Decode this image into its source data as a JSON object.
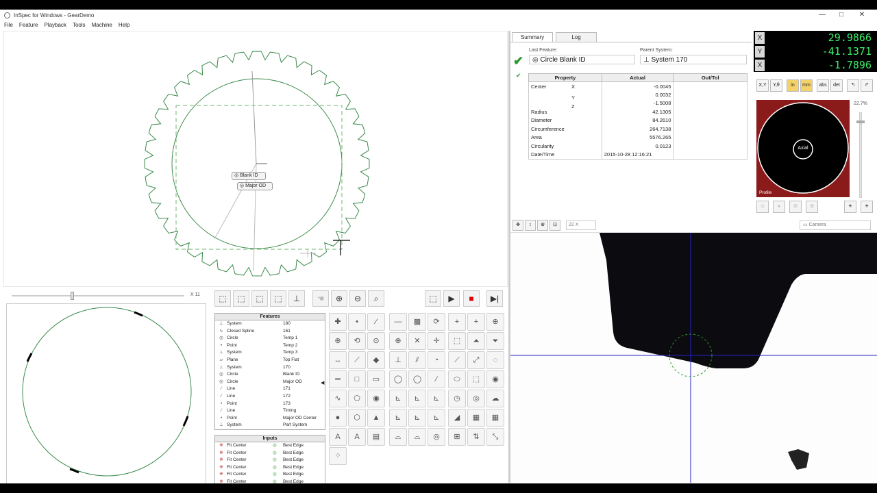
{
  "window": {
    "title": "InSpec for Windows - GearDemo",
    "minimize": "—",
    "maximize": "□",
    "close": "✕"
  },
  "menu": [
    "File",
    "Feature",
    "Playback",
    "Tools",
    "Machine",
    "Help"
  ],
  "canvas": {
    "tags": [
      "Blank ID",
      "Major OD"
    ]
  },
  "summary": {
    "tabs": [
      "Summary",
      "Log"
    ],
    "last_feature_label": "Last Feature:",
    "last_feature": "Circle Blank ID",
    "parent_system_label": "Parent System:",
    "parent_system": "System 170",
    "columns": [
      "Property",
      "Actual",
      "Out/Tol"
    ],
    "rows": [
      {
        "check": false,
        "prop": "Center",
        "axis": "X",
        "actual": "-0.0045"
      },
      {
        "check": false,
        "prop": "",
        "axis": "Y",
        "actual": "0.0032"
      },
      {
        "check": false,
        "prop": "",
        "axis": "Z",
        "actual": "-1.5008"
      },
      {
        "check": false,
        "prop": "Radius",
        "axis": "",
        "actual": "42.1305"
      },
      {
        "check": true,
        "prop": "Diameter",
        "axis": "",
        "actual": "84.2610"
      },
      {
        "check": false,
        "prop": "Circumference",
        "axis": "",
        "actual": "264.7138"
      },
      {
        "check": false,
        "prop": "Area",
        "axis": "",
        "actual": "5576.265"
      },
      {
        "check": false,
        "prop": "Circularity",
        "axis": "",
        "actual": "0.0123"
      },
      {
        "check": false,
        "prop": "Date/Time",
        "axis": "",
        "actual": "2015-10-28 12:16:21"
      }
    ]
  },
  "dro": {
    "x_label": "X",
    "x": "29.9866",
    "y_label": "Y",
    "y": "-41.1371",
    "z_label": "X",
    "z": "-1.7896"
  },
  "dro_tools": [
    "X,Y",
    "Y,θ",
    "in",
    "mm",
    "abs",
    "det",
    "↰",
    "↱"
  ],
  "light": {
    "center_label": "Axial",
    "footer_label": "Profile",
    "zoom_pct": "22.7%"
  },
  "camera": {
    "zoom": "22 X",
    "source": "Camera"
  },
  "preview": {
    "slider_label": "X 11"
  },
  "features": {
    "header": "Features",
    "items": [
      {
        "icon": "system",
        "type": "System",
        "name": "180"
      },
      {
        "icon": "spline",
        "type": "Closed Spline",
        "name": "161"
      },
      {
        "icon": "circle",
        "type": "Circle",
        "name": "Temp 1"
      },
      {
        "icon": "point",
        "type": "Point",
        "name": "Temp 2"
      },
      {
        "icon": "system",
        "type": "System",
        "name": "Temp 3"
      },
      {
        "icon": "plane",
        "type": "Plane",
        "name": "Top Flat"
      },
      {
        "icon": "system",
        "type": "System",
        "name": "170"
      },
      {
        "icon": "circle",
        "type": "Circle",
        "name": "Blank ID"
      },
      {
        "icon": "circle",
        "type": "Circle",
        "name": "Major OD"
      },
      {
        "icon": "line",
        "type": "Line",
        "name": "171"
      },
      {
        "icon": "line",
        "type": "Line",
        "name": "172"
      },
      {
        "icon": "point",
        "type": "Point",
        "name": "173"
      },
      {
        "icon": "line",
        "type": "Line",
        "name": "Timing"
      },
      {
        "icon": "point",
        "type": "Point",
        "name": "Major OD Center"
      },
      {
        "icon": "system",
        "type": "System",
        "name": "Part System"
      }
    ]
  },
  "inputs": {
    "header": "Inputs",
    "items": [
      {
        "type": "Fit Center",
        "edge": "Best Edge"
      },
      {
        "type": "Fit Center",
        "edge": "Best Edge"
      },
      {
        "type": "Fit Center",
        "edge": "Best Edge"
      },
      {
        "type": "Fit Center",
        "edge": "Best Edge"
      },
      {
        "type": "Fit Center",
        "edge": "Best Edge"
      },
      {
        "type": "Fit Center",
        "edge": "Best Edge"
      }
    ]
  },
  "colors": {
    "dro_text": "#3cf06a",
    "light_bg": "#8b1a1a",
    "gear": "#3a8a4a",
    "crosshair": "#2222cc"
  }
}
